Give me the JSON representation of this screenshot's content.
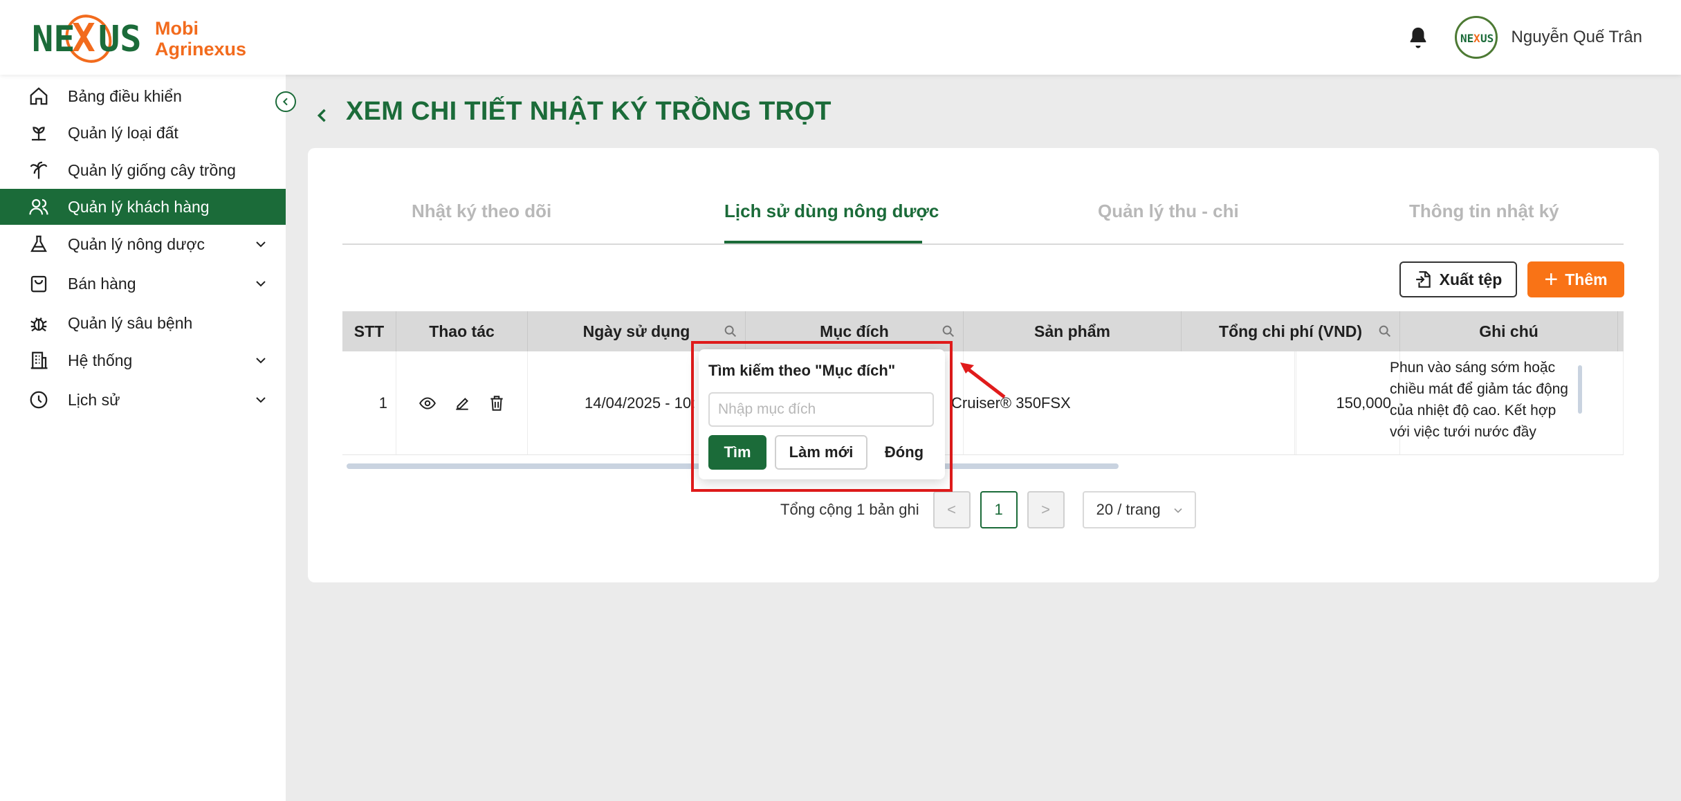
{
  "brand": {
    "line1": "Mobi",
    "line2": "Agrinexus"
  },
  "header": {
    "username": "Nguyễn Quế Trân"
  },
  "sidebar": {
    "items": [
      {
        "label": "Bảng điều khiển",
        "icon": "home-icon",
        "expandable": false,
        "active": false
      },
      {
        "label": "Quản lý loại đất",
        "icon": "sprout-icon",
        "expandable": false,
        "active": false
      },
      {
        "label": "Quản lý giống cây trồng",
        "icon": "palm-icon",
        "expandable": false,
        "active": false
      },
      {
        "label": "Quản lý khách hàng",
        "icon": "users-icon",
        "expandable": false,
        "active": true
      },
      {
        "label": "Quản lý nông dược",
        "icon": "flask-icon",
        "expandable": true,
        "active": false
      },
      {
        "label": "Bán hàng",
        "icon": "shopping-bag-icon",
        "expandable": true,
        "active": false
      },
      {
        "label": "Quản lý sâu bệnh",
        "icon": "bug-icon",
        "expandable": false,
        "active": false
      },
      {
        "label": "Hệ thống",
        "icon": "building-icon",
        "expandable": true,
        "active": false
      },
      {
        "label": "Lịch sử",
        "icon": "clock-icon",
        "expandable": true,
        "active": false
      }
    ]
  },
  "page": {
    "title": "XEM CHI TIẾT NHẬT KÝ TRỒNG TRỌT"
  },
  "tabs": [
    {
      "label": "Nhật ký theo dõi",
      "active": false
    },
    {
      "label": "Lịch sử dùng nông dược",
      "active": true
    },
    {
      "label": "Quản lý thu - chi",
      "active": false
    },
    {
      "label": "Thông tin nhật ký",
      "active": false
    }
  ],
  "toolbar": {
    "export_label": "Xuất tệp",
    "add_label": "Thêm"
  },
  "table": {
    "columns": [
      "STT",
      "Thao tác",
      "Ngày sử dụng",
      "Mục đích",
      "Sản phẩm",
      "Tổng chi phí (VND)",
      "Ghi chú"
    ],
    "rows": [
      {
        "stt": "1",
        "date": "14/04/2025 - 10:",
        "purpose": "",
        "product": "Cruiser® 350FSX",
        "cost": "150,000",
        "note": "Phun vào sáng sớm hoặc chiều mát để giảm tác động của nhiệt độ cao. Kết hợp với việc tưới nước đầy"
      }
    ]
  },
  "pagination": {
    "total": "Tổng cộng 1 bản ghi",
    "current": "1",
    "prev": "<",
    "next": ">",
    "page_size": "20 / trang"
  },
  "filter_popup": {
    "title": "Tìm kiếm theo \"Mục đích\"",
    "placeholder": "Nhập mục đích",
    "search_label": "Tìm",
    "reset_label": "Làm mới",
    "close_label": "Đóng"
  },
  "colors": {
    "primary": "#1b6b39",
    "accent": "#f97316",
    "highlight": "#e01b1b"
  }
}
